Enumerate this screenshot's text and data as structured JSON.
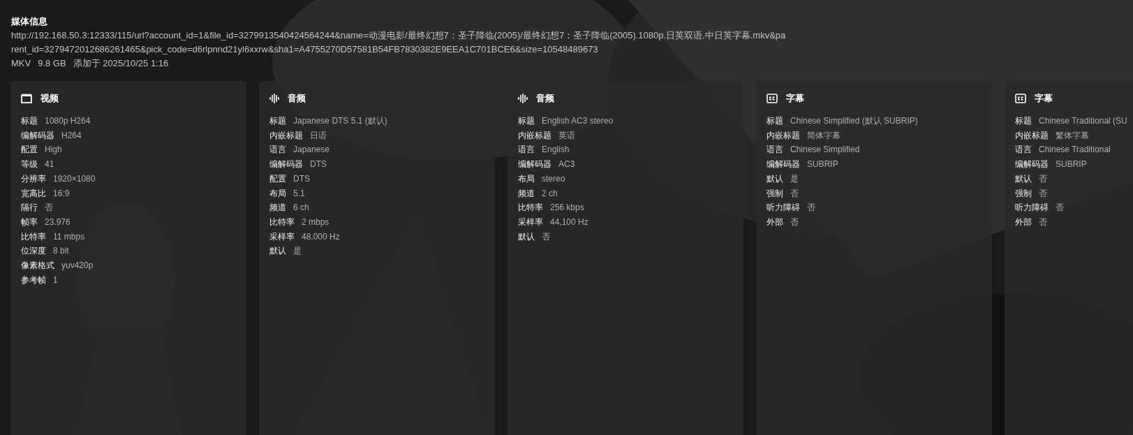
{
  "media_info": {
    "title": "媒体信息",
    "url": "http://192.168.50.3:12333/115/url?account_id=1&file_id=3279913540424564244&name=动漫电影/最终幻想7：圣子降临(2005)/最终幻想7：圣子降临(2005).1080p.日英双语.中日英字幕.mkv&parent_id=3279472012686261465&pick_code=d6rlpnnd21yl6xxrw&sha1=A4755270D57581B54FB7830382E9EEA1C701BCE6&size=10548489673",
    "container": "MKV",
    "size": "9.8 GB",
    "added": "添加于 2025/10/25 1:16"
  },
  "streams": [
    {
      "kind": "video",
      "title": "视频",
      "fields": [
        [
          "标题",
          "1080p H264"
        ],
        [
          "编解码器",
          "H264"
        ],
        [
          "配置",
          "High"
        ],
        [
          "等级",
          "41"
        ],
        [
          "分辨率",
          "1920×1080"
        ],
        [
          "宽高比",
          "16:9"
        ],
        [
          "隔行",
          "否"
        ],
        [
          "帧率",
          "23.976"
        ],
        [
          "比特率",
          "11 mbps"
        ],
        [
          "位深度",
          "8 bit"
        ],
        [
          "像素格式",
          "yuv420p"
        ],
        [
          "参考帧",
          "1"
        ]
      ]
    },
    {
      "kind": "audio",
      "title": "音频",
      "fields": [
        [
          "标题",
          "Japanese DTS 5.1 (默认)"
        ],
        [
          "内嵌标题",
          "日语"
        ],
        [
          "语言",
          "Japanese"
        ],
        [
          "编解码器",
          "DTS"
        ],
        [
          "配置",
          "DTS"
        ],
        [
          "布局",
          "5.1"
        ],
        [
          "频道",
          "6 ch"
        ],
        [
          "比特率",
          "2 mbps"
        ],
        [
          "采样率",
          "48,000 Hz"
        ],
        [
          "默认",
          "是"
        ]
      ]
    },
    {
      "kind": "audio",
      "title": "音频",
      "fields": [
        [
          "标题",
          "English AC3 stereo"
        ],
        [
          "内嵌标题",
          "英语"
        ],
        [
          "语言",
          "English"
        ],
        [
          "编解码器",
          "AC3"
        ],
        [
          "布局",
          "stereo"
        ],
        [
          "频道",
          "2 ch"
        ],
        [
          "比特率",
          "256 kbps"
        ],
        [
          "采样率",
          "44,100 Hz"
        ],
        [
          "默认",
          "否"
        ]
      ]
    },
    {
      "kind": "subtitle",
      "title": "字幕",
      "fields": [
        [
          "标题",
          "Chinese Simplified (默认 SUBRIP)"
        ],
        [
          "内嵌标题",
          "简体字幕"
        ],
        [
          "语言",
          "Chinese Simplified"
        ],
        [
          "编解码器",
          "SUBRIP"
        ],
        [
          "默认",
          "是"
        ],
        [
          "强制",
          "否"
        ],
        [
          "听力障碍",
          "否"
        ],
        [
          "外部",
          "否"
        ]
      ]
    },
    {
      "kind": "subtitle",
      "title": "字幕",
      "fields": [
        [
          "标题",
          "Chinese Traditional (SU"
        ],
        [
          "内嵌标题",
          "繁体字幕"
        ],
        [
          "语言",
          "Chinese Traditional"
        ],
        [
          "编解码器",
          "SUBRIP"
        ],
        [
          "默认",
          "否"
        ],
        [
          "强制",
          "否"
        ],
        [
          "听力障碍",
          "否"
        ],
        [
          "外部",
          "否"
        ]
      ]
    }
  ]
}
